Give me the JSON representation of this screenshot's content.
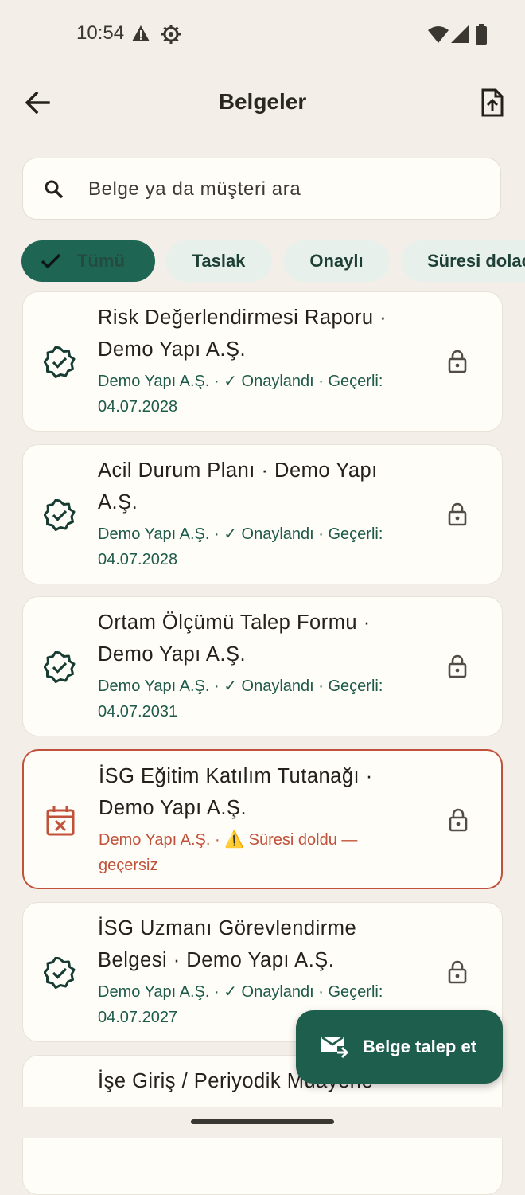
{
  "status_bar": {
    "time": "10:54",
    "icons": [
      "alert-triangle-icon",
      "settings-gear-icon",
      "wifi-icon",
      "cell-signal-icon",
      "battery-icon"
    ]
  },
  "header": {
    "title": "Belgeler",
    "back_icon": "arrow-back-icon",
    "upload_icon": "file-upload-icon"
  },
  "search": {
    "placeholder": "Belge ya da müşteri ara",
    "value": ""
  },
  "filters": {
    "chips": [
      {
        "label": "Tümü",
        "selected": true
      },
      {
        "label": "Taslak",
        "selected": false
      },
      {
        "label": "Onaylı",
        "selected": false
      },
      {
        "label": "Süresi dolac",
        "selected": false
      }
    ]
  },
  "documents": [
    {
      "title": "Risk Değerlendirmesi Raporu · Demo Yapı A.Ş.",
      "subtitle": "Demo Yapı A.Ş. · ✓ Onaylandı · Geçerli: 04.07.2028",
      "status": "approved",
      "icon": "verified-badge-icon"
    },
    {
      "title": "Acil Durum Planı · Demo Yapı A.Ş.",
      "subtitle": "Demo Yapı A.Ş. · ✓ Onaylandı · Geçerli: 04.07.2028",
      "status": "approved",
      "icon": "verified-badge-icon"
    },
    {
      "title": "Ortam Ölçümü Talep Formu · Demo Yapı A.Ş.",
      "subtitle": "Demo Yapı A.Ş. · ✓ Onaylandı · Geçerli: 04.07.2031",
      "status": "approved",
      "icon": "verified-badge-icon"
    },
    {
      "title": "İSG Eğitim Katılım Tutanağı · Demo Yapı A.Ş.",
      "subtitle": "Demo Yapı A.Ş. · ⚠️ Süresi doldu — geçersiz",
      "status": "expired",
      "icon": "calendar-x-icon"
    },
    {
      "title": "İSG Uzmanı Görevlendirme Belgesi · Demo Yapı A.Ş.",
      "subtitle": "Demo Yapı A.Ş. · ✓ Onaylandı · Geçerli: 04.07.2027",
      "status": "approved",
      "icon": "verified-badge-icon"
    },
    {
      "title": "İşe Giriş / Periyodik Muayene",
      "subtitle": "",
      "status": "approved",
      "icon": "verified-badge-icon"
    }
  ],
  "fab": {
    "label": "Belge talep et",
    "icon": "mail-forward-icon"
  },
  "colors": {
    "primary": "#1e5e4d",
    "approved_text": "#1d5a4a",
    "expired": "#c0513a",
    "background": "#f3efe8",
    "surface": "#fffdf8"
  }
}
